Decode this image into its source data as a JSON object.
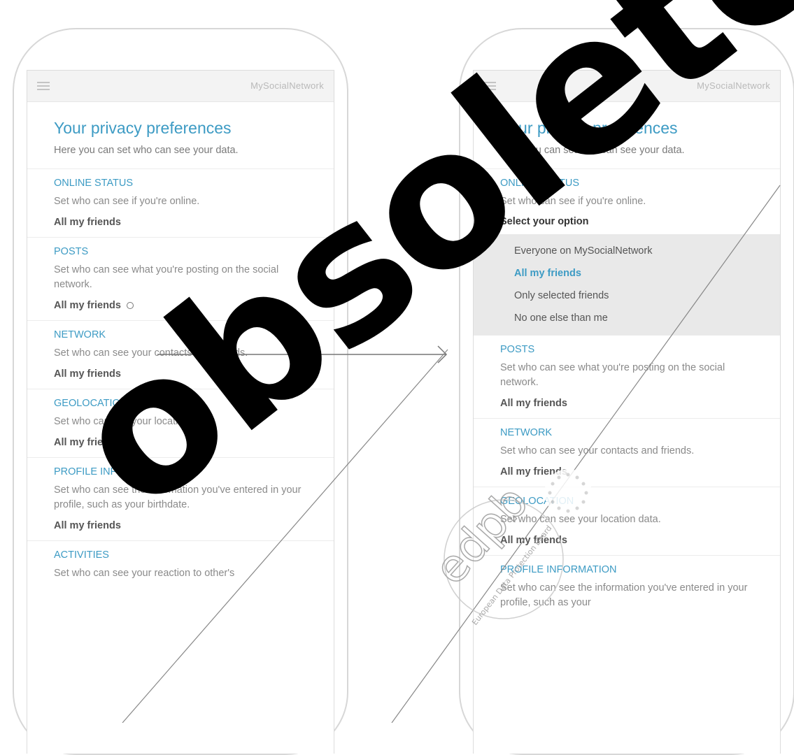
{
  "left_phone": {
    "brand": "MySocialNetwork",
    "title": "Your privacy preferences",
    "subtitle": "Here you can set who can see your data.",
    "sections": [
      {
        "title": "ONLINE STATUS",
        "desc": "Set who can see if you're online.",
        "value": "All my friends"
      },
      {
        "title": "POSTS",
        "desc": "Set who can see what you're posting on the social network.",
        "value": "All my friends"
      },
      {
        "title": "NETWORK",
        "desc": "Set who can see your contacts and friends.",
        "value": "All my friends"
      },
      {
        "title": "GEOLOCATION",
        "desc": "Set who can see your location data.",
        "value": "All my friends"
      },
      {
        "title": "PROFILE INFORMATION",
        "desc": "Set who can see the information you've entered in your profile, such as your birthdate.",
        "value": "All my friends"
      },
      {
        "title": "ACTIVITIES",
        "desc": "Set who can see your reaction to other's"
      }
    ]
  },
  "right_phone": {
    "brand": "MySocialNetwork",
    "title": "Your privacy preferences",
    "subtitle": "Here you can set who can see your data.",
    "online": {
      "title": "ONLINE STATUS",
      "desc": "Set who can see if you're online.",
      "select_label": "Select your option"
    },
    "options": [
      "Everyone on MySocialNetwork",
      "All my friends",
      "Only selected friends",
      "No one else than me"
    ],
    "selected_option": "All my friends",
    "sections": [
      {
        "title": "POSTS",
        "desc": "Set who can see what you're posting on the social network.",
        "value": "All my friends"
      },
      {
        "title": "NETWORK",
        "desc": "Set who can see your contacts and friends.",
        "value": "All my friends"
      },
      {
        "title": "GEOLOCATION",
        "desc": "Set who can see your location data.",
        "value": "All my friends"
      },
      {
        "title": "PROFILE INFORMATION",
        "desc": "Set who can see the information you've entered in your profile, such as your"
      }
    ]
  },
  "watermark": {
    "text": "obsolete",
    "seal_letters": "edpb",
    "seal_caption": "European Data Protection Board"
  },
  "colors": {
    "accent": "#3d9bc4",
    "option_bg": "#e9e9e9"
  }
}
